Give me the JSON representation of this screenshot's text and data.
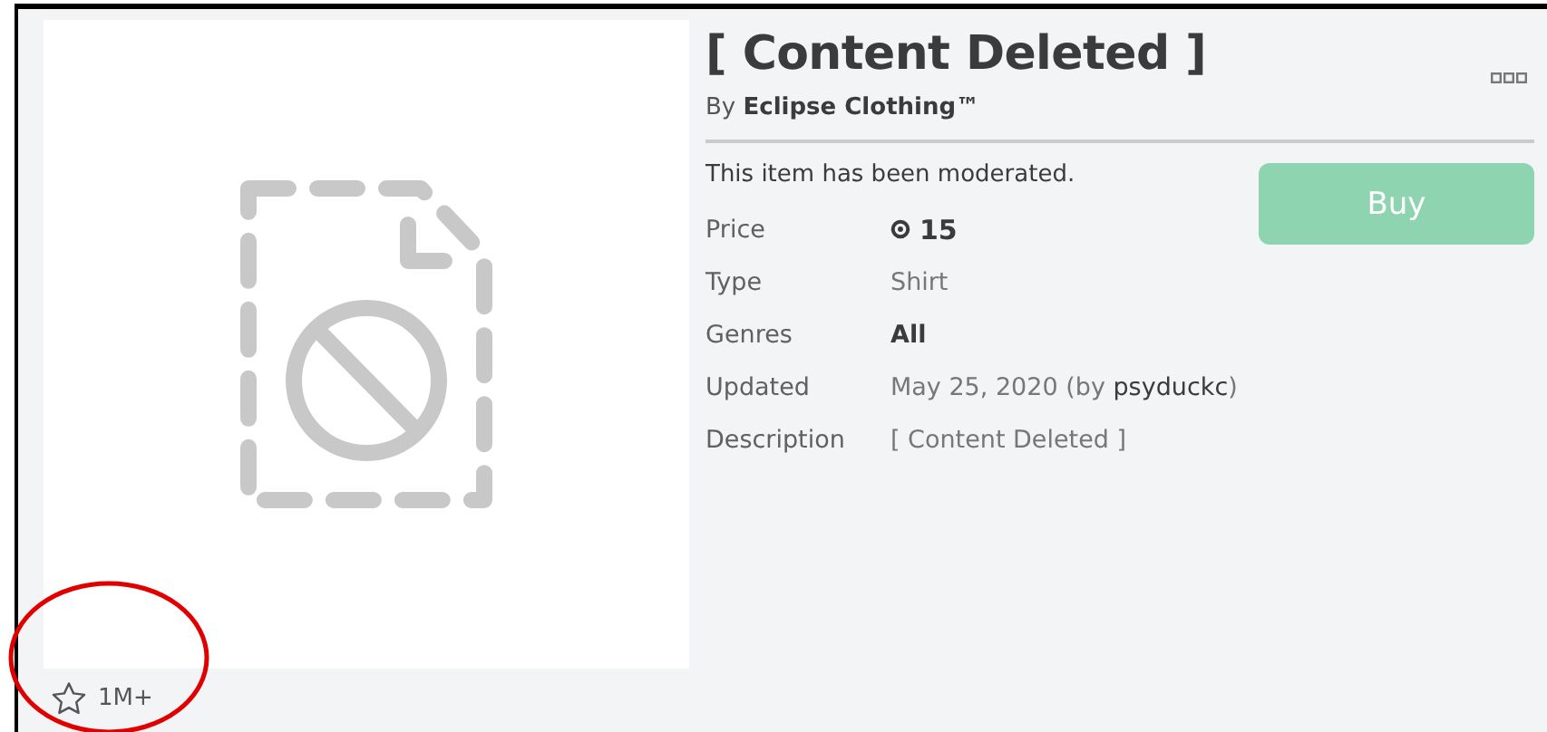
{
  "item": {
    "title": "[ Content Deleted ]",
    "creator": "By **Eclipse Clothing™**",
    "notice": "This item has been moderated.",
    "buy_button": {
      "label": "Buy",
      "disabled": true
    },
    "details": [
      {
        "kind": "price",
        "label": "Price",
        "value": "15"
      },
      {
        "kind": "text",
        "label": "Type",
        "value": "Shirt",
        "bold": false
      },
      {
        "kind": "text",
        "label": "Genres",
        "value": "All",
        "bold": true
      },
      {
        "kind": "text",
        "label": "Updated",
        "value": "May 25, 2020 (by **psyduckc**)",
        "bold": false
      },
      {
        "kind": "text",
        "label": "Description",
        "value": "[ Content Deleted ]",
        "bold": false
      }
    ],
    "favorites": {
      "count": "1M+",
      "favorited": false
    }
  }
}
